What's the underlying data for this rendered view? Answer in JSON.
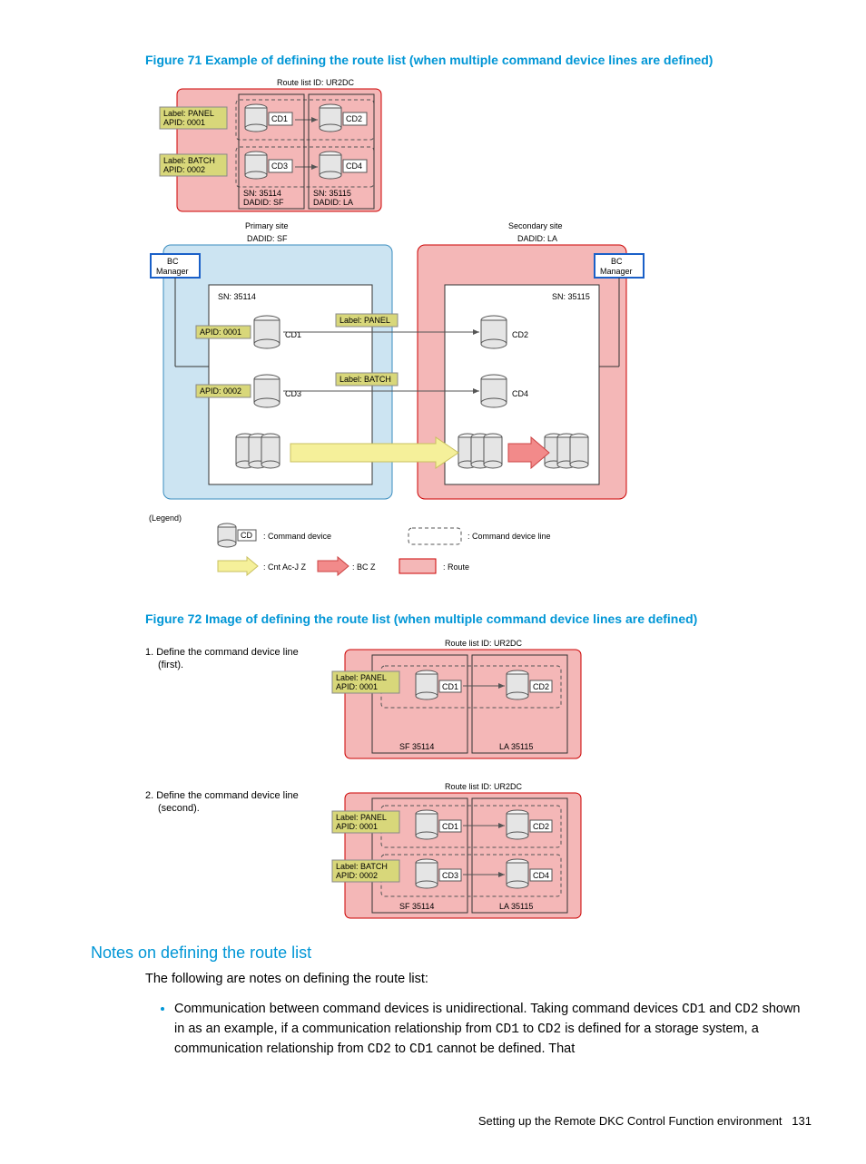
{
  "figure71": {
    "caption": "Figure 71 Example of defining the route list (when multiple command device lines are defined)",
    "route_id": "Route list ID: UR2DC",
    "label_panel": "Label: PANEL\nAPID: 0001",
    "label_batch": "Label: BATCH\nAPID: 0002",
    "cd1": "CD1",
    "cd2": "CD2",
    "cd3": "CD3",
    "cd4": "CD4",
    "sn1": "SN: 35114\nDADID: SF",
    "sn2": "SN: 35115\nDADID: LA",
    "primary_site": "Primary site",
    "secondary_site": "Secondary site",
    "dadid_sf": "DADID: SF",
    "dadid_la": "DADID: LA",
    "bc_manager": "BC\nManager",
    "sn_35114": "SN: 35114",
    "sn_35115": "SN: 35115",
    "apid1": "APID: 0001",
    "apid2": "APID: 0002",
    "panel": "Label: PANEL",
    "batch": "Label: BATCH",
    "legend": "(Legend)",
    "cd_label": "CD",
    "cmd_device": ": Command device",
    "cmd_line": ": Command device line",
    "cnt": ": Cnt Ac-J Z",
    "bcz": ": BC Z",
    "route": ": Route"
  },
  "figure72": {
    "caption": "Figure 72 Image of defining the route list (when multiple command device lines are defined)",
    "step1": "1. Define the command device line\n    (first).",
    "step2": "2. Define the command device line\n    (second).",
    "route_id": "Route list ID: UR2DC",
    "label_panel": "Label: PANEL\nAPID: 0001",
    "label_batch": "Label: BATCH\nAPID: 0002",
    "cd1": "CD1",
    "cd2": "CD2",
    "cd3": "CD3",
    "cd4": "CD4",
    "sf": "SF 35114",
    "la": "LA 35115"
  },
  "notes": {
    "title": "Notes on defining the route list",
    "intro": "The following are notes on defining the route list:",
    "bullet1_a": "Communication between command devices is unidirectional. Taking command devices ",
    "cd1": "CD1",
    "bullet1_b": " and ",
    "cd2": "CD2",
    "bullet1_c": " shown in as an example, if a communication relationship from ",
    "bullet1_d": " to ",
    "bullet1_e": " is defined for a storage system, a communication relationship from ",
    "bullet1_f": " cannot be defined. That"
  },
  "footer": {
    "text": "Setting up the Remote DKC Control Function environment",
    "page": "131"
  }
}
